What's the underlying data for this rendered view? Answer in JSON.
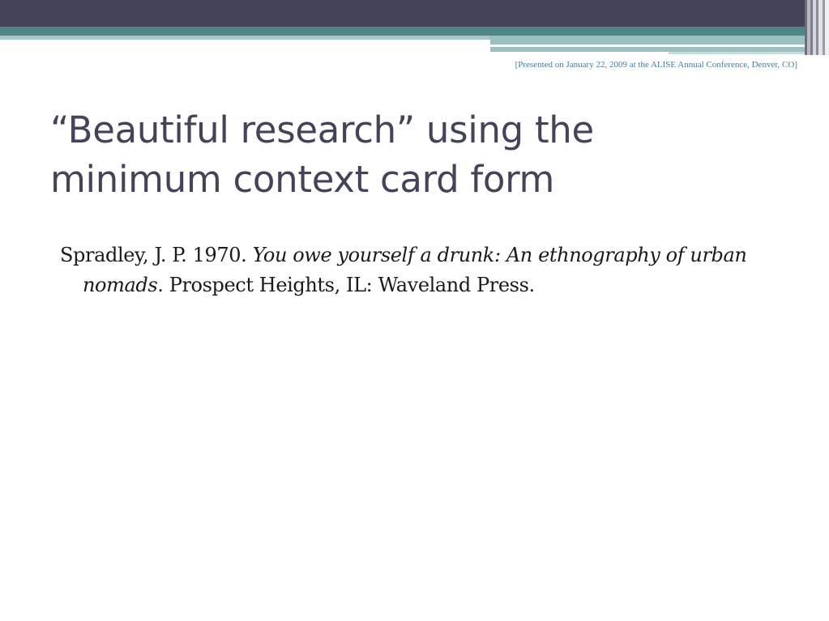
{
  "header_note": "[Presented on January 22, 2009 at the ALISE Annual Conference, Denver, CO]",
  "title_line1": "“Beautiful research” using the",
  "title_line2": "minimum context card form",
  "citation": {
    "author_year": "Spradley, J. P. 1970. ",
    "book_title": "You owe yourself a drunk: An ethnography of urban nomads",
    "publisher": ". Prospect Heights, IL: Waveland Press."
  },
  "colors": {
    "band_dark": "#434459",
    "band_teal": "#4f8688",
    "title_color": "#434459",
    "note_color": "#4a7b9a"
  }
}
